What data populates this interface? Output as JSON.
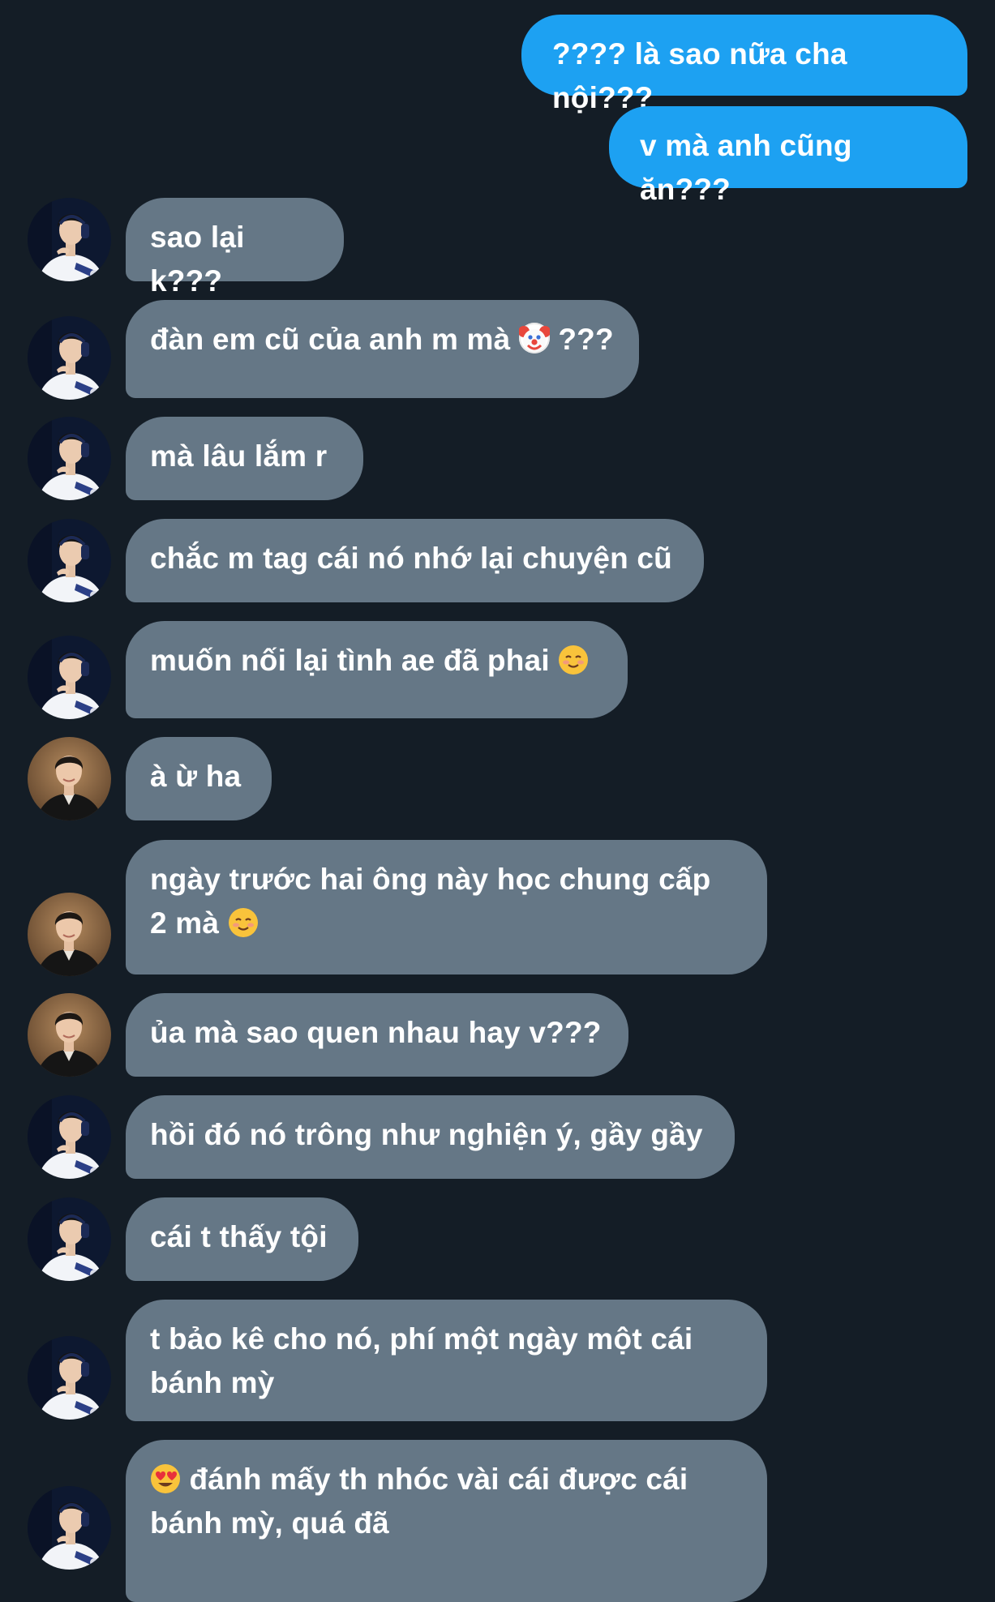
{
  "conversation": {
    "messages": [
      {
        "side": "out",
        "text": "???? là sao nữa cha nội???"
      },
      {
        "side": "out",
        "text": "v mà anh cũng ăn???"
      },
      {
        "side": "in",
        "avatar": "avatar-a",
        "text": "sao lại k???"
      },
      {
        "side": "in",
        "avatar": "avatar-a",
        "text": "đàn em cũ của anh m mà {emoji} ???",
        "emoji": "clown-face-emoji"
      },
      {
        "side": "in",
        "avatar": "avatar-a",
        "text": "mà lâu lắm r"
      },
      {
        "side": "in",
        "avatar": "avatar-a",
        "text": "chắc m tag cái nó nhớ lại chuyện cũ"
      },
      {
        "side": "in",
        "avatar": "avatar-a",
        "text": "muốn nối lại tình ae đã phai {emoji}",
        "emoji": "smiling-face-emoji"
      },
      {
        "side": "in",
        "avatar": "avatar-b",
        "text": "à ừ ha"
      },
      {
        "side": "in",
        "avatar": "avatar-b",
        "text": "ngày trước hai ông này học chung cấp\n2 mà {emoji}",
        "emoji": "smiling-face-emoji"
      },
      {
        "side": "in",
        "avatar": "avatar-b",
        "text": "ủa mà sao quen nhau hay v???"
      },
      {
        "side": "in",
        "avatar": "avatar-a",
        "text": "hồi đó nó trông như nghiện ý, gầy gầy"
      },
      {
        "side": "in",
        "avatar": "avatar-a",
        "text": "cái t thấy tội"
      },
      {
        "side": "in",
        "avatar": "avatar-a",
        "text": "t bảo kê cho nó, phí một ngày một cái\nbánh mỳ"
      },
      {
        "side": "in",
        "avatar": "avatar-a",
        "text": "{emoji} đánh mấy th nhóc vài cái được cái\nbánh mỳ, quá đã",
        "emoji": "heart-eyes-emoji"
      }
    ]
  },
  "colors": {
    "background": "#141d26",
    "incoming_bubble": "#657786",
    "outgoing_bubble": "#1da1f2",
    "text": "#ffffff"
  }
}
